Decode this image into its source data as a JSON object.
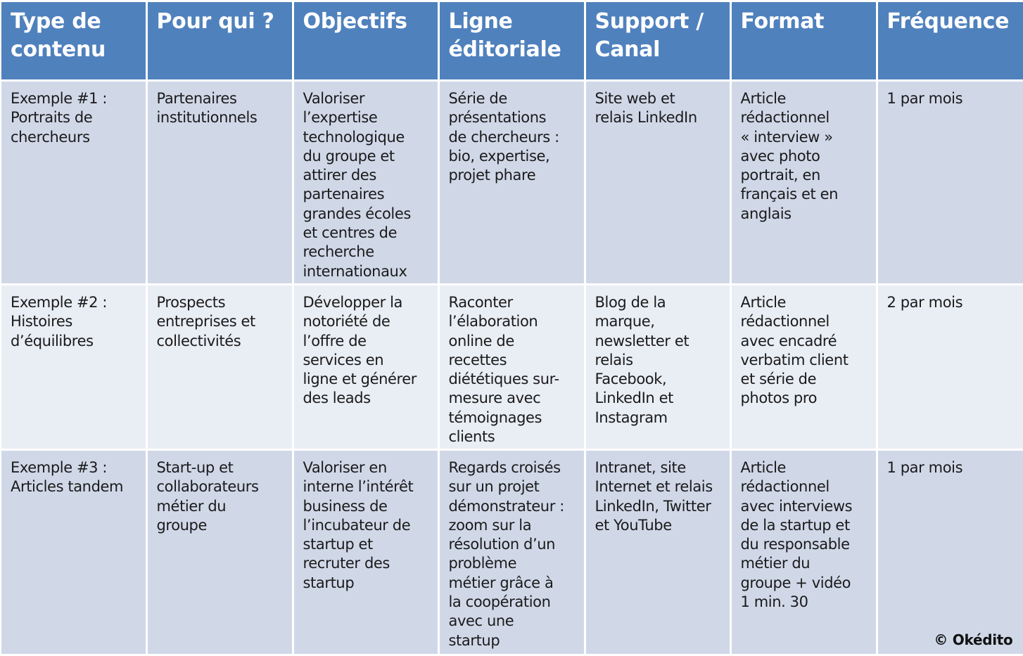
{
  "table": {
    "headers": [
      [
        "Type de",
        "contenu"
      ],
      [
        "Pour qui ?"
      ],
      [
        "Objectifs"
      ],
      [
        "Ligne",
        "éditoriale"
      ],
      [
        "Support /",
        "Canal"
      ],
      [
        "Format"
      ],
      [
        "Fréquence"
      ]
    ],
    "rows": [
      {
        "type": [
          "Exemple #1 :",
          "Portraits de",
          "chercheurs"
        ],
        "audience": [
          "Partenaires",
          "institutionnels"
        ],
        "objectives": [
          "Valoriser",
          "l’expertise",
          "technologique",
          "du groupe et",
          "attirer des",
          "partenaires",
          "grandes écoles",
          "et centres de",
          "recherche",
          "internationaux"
        ],
        "editorial_line": [
          "Série de",
          "présentations",
          "de chercheurs :",
          "bio, expertise,",
          "projet phare"
        ],
        "channel": [
          "Site web et",
          "relais LinkedIn"
        ],
        "format": [
          "Article",
          "rédactionnel",
          "« interview »",
          "avec photo",
          "portrait, en",
          "français et en",
          "anglais"
        ],
        "frequency": [
          "1 par mois"
        ]
      },
      {
        "type": [
          "Exemple #2 :",
          "Histoires",
          "d’équilibres"
        ],
        "audience": [
          "Prospects",
          "entreprises et",
          "collectivités"
        ],
        "objectives": [
          "Développer la",
          "notoriété de",
          "l’offre de",
          "services en",
          "ligne et générer",
          "des leads"
        ],
        "editorial_line": [
          "Raconter",
          "l’élaboration",
          "online de",
          "recettes",
          "diététiques sur-",
          "mesure avec",
          "témoignages",
          "clients"
        ],
        "channel": [
          "Blog de la",
          "marque,",
          "newsletter et",
          "relais",
          "Facebook,",
          "LinkedIn et",
          "Instagram"
        ],
        "format": [
          "Article",
          "rédactionnel",
          "avec encadré",
          "verbatim client",
          "et série de",
          "photos pro"
        ],
        "frequency": [
          "2 par mois"
        ]
      },
      {
        "type": [
          "Exemple #3 :",
          "Articles tandem"
        ],
        "audience": [
          "Start-up et",
          "collaborateurs",
          "métier du",
          "groupe"
        ],
        "objectives": [
          "Valoriser en",
          "interne l’intérêt",
          "business de",
          "l’incubateur de",
          "startup et",
          "recruter des",
          "startup"
        ],
        "editorial_line": [
          "Regards croisés",
          "sur un projet",
          "démonstrateur :",
          "zoom sur la",
          "résolution d’un",
          "problème",
          "métier grâce à",
          "la coopération",
          "avec une",
          "startup"
        ],
        "channel": [
          "Intranet, site",
          "Internet et relais",
          "LinkedIn, Twitter",
          "et YouTube"
        ],
        "format": [
          "Article",
          "rédactionnel",
          "avec interviews",
          "de la startup et",
          "du responsable",
          "métier du",
          "groupe + vidéo",
          "1 min. 30"
        ],
        "frequency": [
          "1 par mois"
        ]
      }
    ]
  },
  "footer": {
    "copyright": "© Okédito"
  },
  "colors": {
    "header_bg": "#4f81bd",
    "header_text": "#ffffff",
    "row_odd_bg": "#d0d8e8",
    "row_even_bg": "#e9edf4",
    "body_text": "#1a1a1a"
  }
}
